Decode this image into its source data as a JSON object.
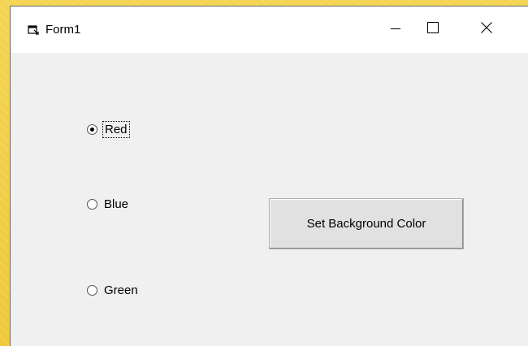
{
  "window": {
    "title": "Form1",
    "title_icon": "form-window-icon",
    "controls": {
      "minimize_icon": "minimize-icon",
      "maximize_icon": "maximize-icon",
      "close_icon": "close-icon"
    }
  },
  "radios": [
    {
      "label": "Red",
      "checked": true,
      "focused": true
    },
    {
      "label": "Blue",
      "checked": false,
      "focused": false
    },
    {
      "label": "Green",
      "checked": false,
      "focused": false
    }
  ],
  "button": {
    "label": "Set Background Color"
  },
  "colors": {
    "desktop": "#f3d14a",
    "form_bg": "#f0f0f0",
    "titlebar": "#ffffff",
    "button_face": "#e1e1e1"
  }
}
